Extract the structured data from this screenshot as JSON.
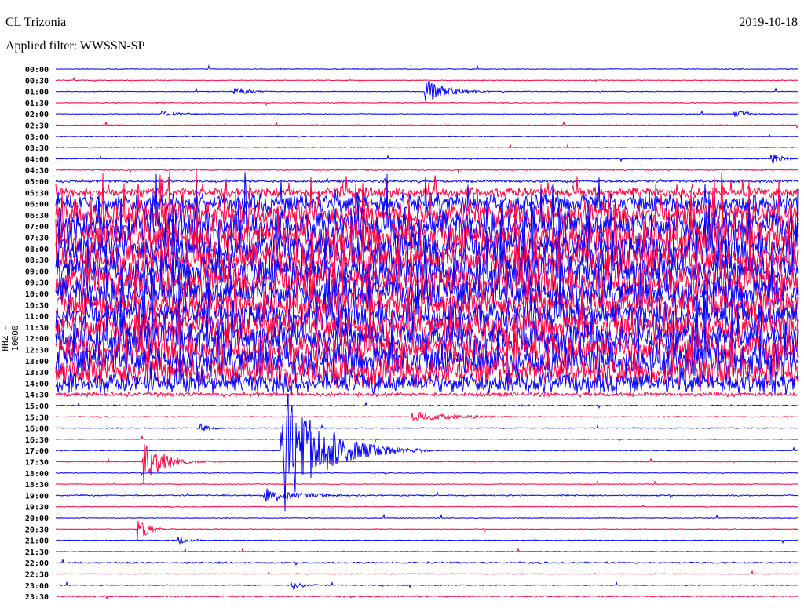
{
  "chart_data": {
    "type": "line",
    "title": "CL Trizonia",
    "subtitle": "Applied filter: WWSSN-SP",
    "date": "2019-10-18",
    "ylabel": "HHZ - 10000",
    "row_minutes": 30,
    "row_labels": [
      "00:00",
      "00:30",
      "01:00",
      "01:30",
      "02:00",
      "02:30",
      "03:00",
      "03:30",
      "04:00",
      "04:30",
      "05:00",
      "05:30",
      "06:00",
      "06:30",
      "07:00",
      "07:30",
      "08:00",
      "08:30",
      "09:00",
      "09:30",
      "10:00",
      "10:30",
      "11:00",
      "11:30",
      "12:00",
      "12:30",
      "13:00",
      "13:30",
      "14:00",
      "14:30",
      "15:00",
      "15:30",
      "16:00",
      "16:30",
      "17:00",
      "17:30",
      "18:00",
      "18:30",
      "19:00",
      "19:30",
      "20:00",
      "20:30",
      "21:00",
      "21:30",
      "22:00",
      "22:30",
      "23:00",
      "23:30"
    ],
    "series_colors": [
      "#0000ff",
      "#ff0040"
    ],
    "noise_level": [
      0.05,
      0.05,
      0.05,
      0.05,
      0.05,
      0.05,
      0.05,
      0.06,
      0.06,
      0.08,
      0.15,
      0.6,
      1.2,
      1.6,
      1.9,
      2.0,
      2.1,
      2.0,
      2.0,
      2.1,
      1.9,
      1.7,
      1.8,
      1.8,
      1.9,
      1.9,
      1.9,
      1.8,
      1.3,
      0.25,
      0.08,
      0.06,
      0.06,
      0.05,
      0.05,
      0.05,
      0.05,
      0.05,
      0.08,
      0.05,
      0.05,
      0.05,
      0.05,
      0.05,
      0.1,
      0.05,
      0.06,
      0.08
    ],
    "events": [
      {
        "row": 2,
        "minute": 15.0,
        "amplitude": 1.2,
        "duration": 0.8
      },
      {
        "row": 2,
        "minute": 7.3,
        "amplitude": 0.3,
        "duration": 0.8
      },
      {
        "row": 4,
        "minute": 4.3,
        "amplitude": 0.3,
        "duration": 0.8
      },
      {
        "row": 4,
        "minute": 27.5,
        "amplitude": 0.3,
        "duration": 0.6
      },
      {
        "row": 8,
        "minute": 29.0,
        "amplitude": 0.5,
        "duration": 0.4
      },
      {
        "row": 31,
        "minute": 14.5,
        "amplitude": 0.5,
        "duration": 1.5
      },
      {
        "row": 32,
        "minute": 5.9,
        "amplitude": 0.4,
        "duration": 0.4
      },
      {
        "row": 34,
        "minute": 9.2,
        "amplitude": 6.0,
        "duration": 1.5
      },
      {
        "row": 35,
        "minute": 3.6,
        "amplitude": 2.0,
        "duration": 0.8
      },
      {
        "row": 38,
        "minute": 8.5,
        "amplitude": 0.6,
        "duration": 1.5
      },
      {
        "row": 41,
        "minute": 3.4,
        "amplitude": 1.0,
        "duration": 0.4
      },
      {
        "row": 42,
        "minute": 5.0,
        "amplitude": 0.3,
        "duration": 0.5
      },
      {
        "row": 46,
        "minute": 9.6,
        "amplitude": 0.4,
        "duration": 0.5
      }
    ]
  }
}
